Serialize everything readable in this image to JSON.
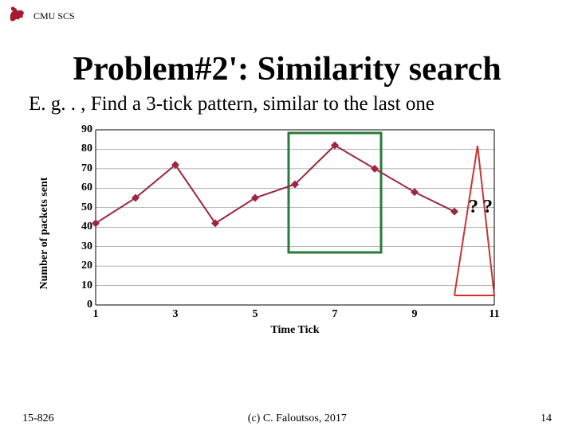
{
  "header": {
    "org": "CMU SCS"
  },
  "title": "Problem#2': Similarity search",
  "subtitle": "E. g. . , Find a 3-tick pattern, similar to the last one",
  "chart_data": {
    "type": "line",
    "x": [
      1,
      2,
      3,
      4,
      5,
      6,
      7,
      8,
      9,
      10,
      11
    ],
    "values": [
      42,
      55,
      72,
      42,
      55,
      62,
      82,
      70,
      58,
      48,
      null
    ],
    "xlabel": "Time Tick",
    "ylabel": "Number of packets sent",
    "xticks": [
      1,
      3,
      5,
      7,
      9,
      11
    ],
    "yticks": [
      0,
      10,
      20,
      30,
      40,
      50,
      60,
      70,
      80,
      90
    ],
    "ylim": [
      0,
      90
    ],
    "xlim": [
      1,
      11
    ],
    "highlight_box_x": [
      6,
      8
    ],
    "callout_x_range": [
      10,
      11
    ],
    "annotation": "? ?",
    "marker_color": "#9b2742",
    "line_color": "#9b2742"
  },
  "footer": {
    "left": "15-826",
    "center": "(c) C. Faloutsos, 2017",
    "right": "14"
  },
  "brand_color": "#a6192e"
}
